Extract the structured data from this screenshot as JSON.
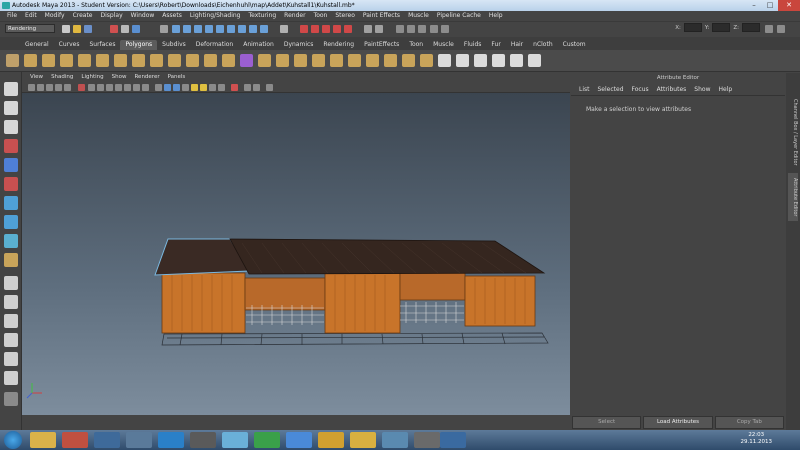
{
  "window": {
    "title": "Autodesk Maya 2013 - Student Version: C:\\Users\\Robert\\Downloads\\Eichenhuhl\\map\\Addet\\Kuhstall1\\Kuhstall.mb*"
  },
  "menubar": [
    "File",
    "Edit",
    "Modify",
    "Create",
    "Display",
    "Window",
    "Assets",
    "Lighting/Shading",
    "Texturing",
    "Render",
    "Toon",
    "Stereo",
    "Paint Effects",
    "Muscle",
    "Pipeline Cache",
    "Help"
  ],
  "status_line": {
    "mode": "Rendering",
    "x_label": "X:",
    "y_label": "Y:",
    "z_label": "Z:"
  },
  "shelf_tabs": [
    "General",
    "Curves",
    "Surfaces",
    "Polygons",
    "Subdivs",
    "Deformation",
    "Animation",
    "Dynamics",
    "Rendering",
    "PaintEffects",
    "Toon",
    "Muscle",
    "Fluids",
    "Fur",
    "Hair",
    "nCloth",
    "Custom"
  ],
  "active_shelf_tab": "Polygons",
  "viewport_menu": [
    "View",
    "Shading",
    "Lighting",
    "Show",
    "Renderer",
    "Panels"
  ],
  "attribute_editor": {
    "title": "Attribute Editor",
    "menu": [
      "List",
      "Selected",
      "Focus",
      "Attributes",
      "Show",
      "Help"
    ],
    "message": "Make a selection to view attributes",
    "buttons": {
      "select": "Select",
      "load": "Load Attributes",
      "copy": "Copy Tab"
    }
  },
  "side_tabs": {
    "channel_box": "Channel Box / Layer Editor",
    "attribute_editor": "Attribute Editor"
  },
  "clock": {
    "time": "22:03",
    "date": "29.11.2013"
  },
  "colors": {
    "viewport_top": "#3b4550",
    "viewport_bottom": "#7d8d9d",
    "wood": "#c8742a",
    "roof": "#3a2a24",
    "accent_tab": "#5c5c5c"
  }
}
